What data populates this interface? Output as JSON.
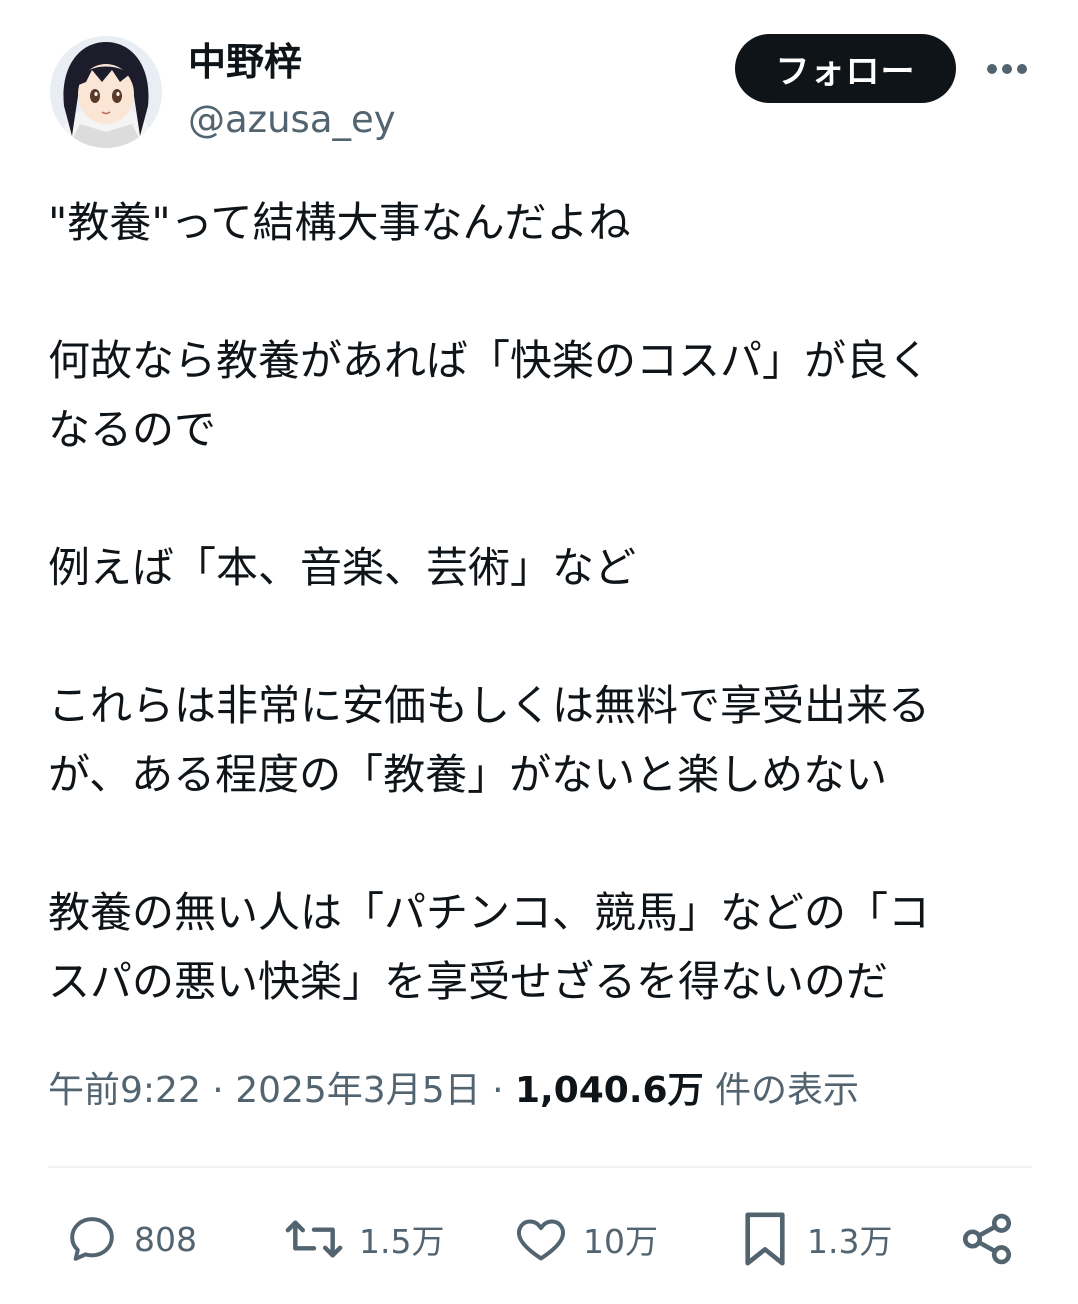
{
  "author": {
    "display_name": "中野梓",
    "handle": "@azusa_ey"
  },
  "header": {
    "follow_label": "フォロー",
    "more_icon": "more-icon"
  },
  "tweet": {
    "paragraphs": [
      "\"教養\"って結構大事なんだよね",
      "何故なら教養があれば「快楽のコスパ」が良く\nなるので",
      "例えば「本、音楽、芸術」など",
      "これらは非常に安価もしくは無料で享受出来る\nが、ある程度の「教養」がないと楽しめない",
      "教養の無い人は「パチンコ、競馬」などの「コ\nスパの悪い快楽」を享受せざるを得ないのだ"
    ]
  },
  "meta": {
    "time": "午前9:22",
    "sep1": " · ",
    "date": "2025年3月5日",
    "sep2": " · ",
    "views_count": "1,040.6万",
    "views_label": " 件の表示"
  },
  "actions": {
    "replies": "808",
    "reposts": "1.5万",
    "likes": "10万",
    "bookmarks": "1.3万"
  },
  "colors": {
    "text": "#0f1419",
    "secondary": "#536471",
    "button_bg": "#0f1419",
    "divider": "#eff3f4"
  }
}
